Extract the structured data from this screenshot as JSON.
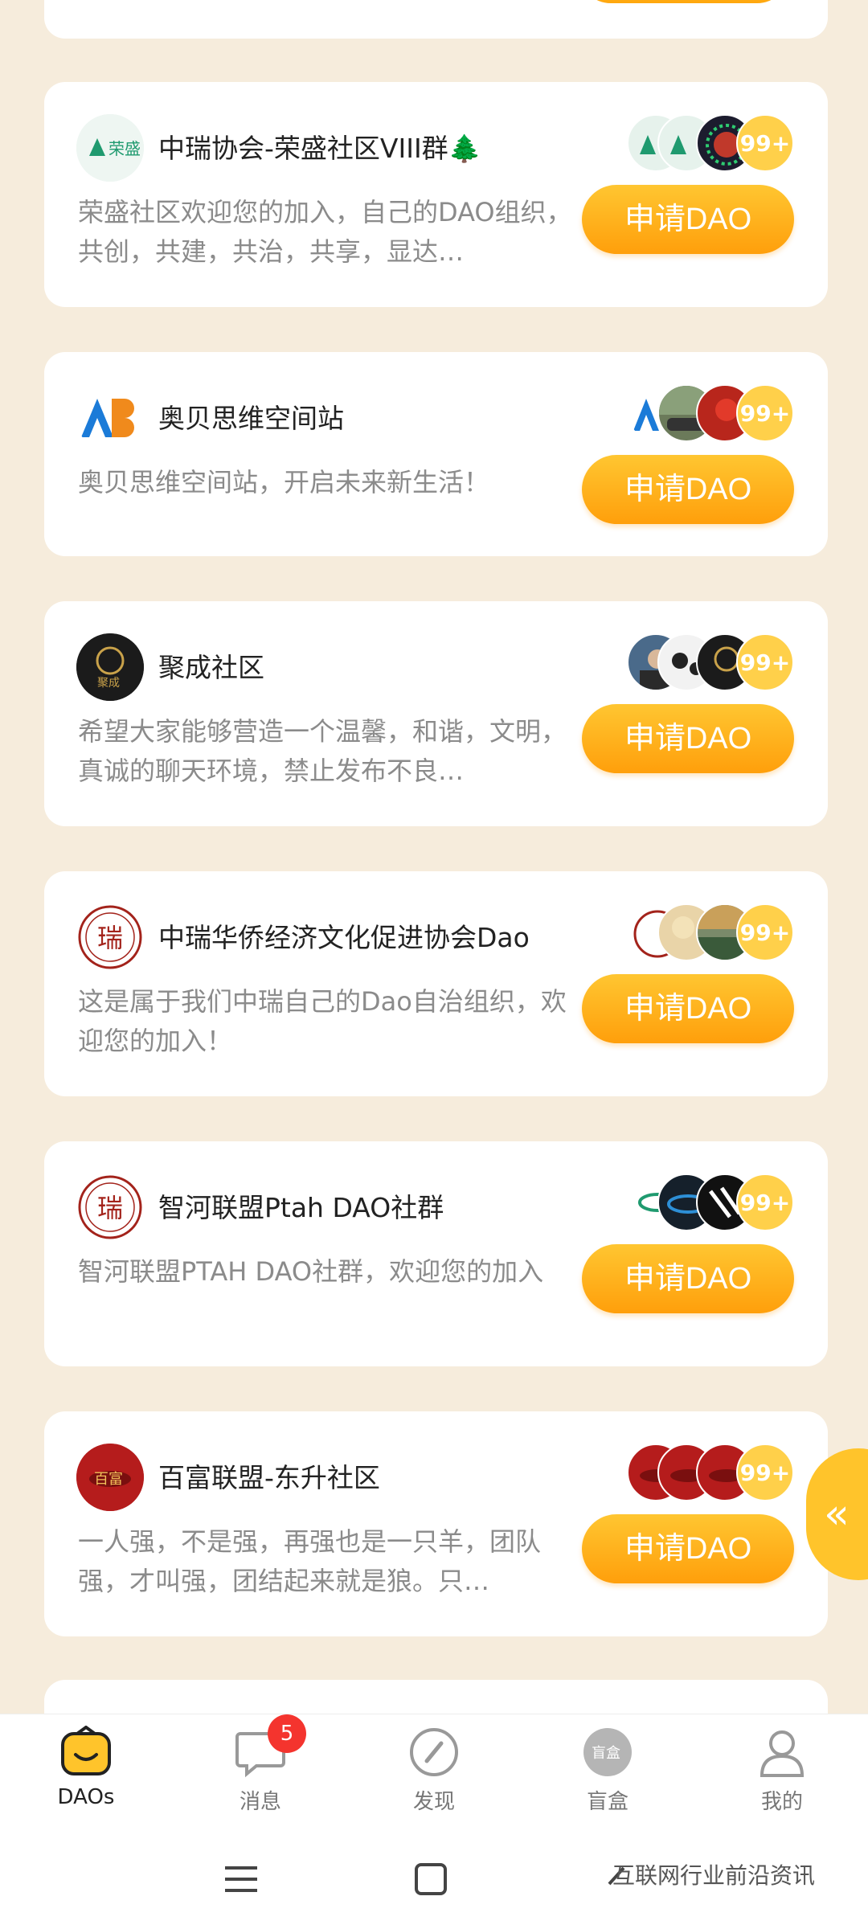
{
  "communities": [
    {
      "name": "中瑞协会-荣盛社区VIII群🌲",
      "description": "荣盛社区欢迎您的加入，自己的DAO组织，共创，共建，共治，共享，显达…",
      "more_count": "99+",
      "button_label": "申请DAO",
      "avatar_text": "荣盛"
    },
    {
      "name": "奥贝思维空间站",
      "description": "奥贝思维空间站，开启未来新生活！",
      "more_count": "99+",
      "button_label": "申请DAO",
      "avatar_text": "AB"
    },
    {
      "name": "聚成社区",
      "description": "希望大家能够营造一个温馨，和谐，文明，真诚的聊天环境，禁止发布不良…",
      "more_count": "99+",
      "button_label": "申请DAO",
      "avatar_text": "聚成"
    },
    {
      "name": "中瑞华侨经济文化促进协会Dao",
      "description": "这是属于我们中瑞自己的Dao自治组织，欢迎您的加入！",
      "more_count": "99+",
      "button_label": "申请DAO",
      "avatar_text": "瑞"
    },
    {
      "name": "智河联盟Ptah DAO社群",
      "description": "智河联盟PTAH DAO社群，欢迎您的加入",
      "more_count": "99+",
      "button_label": "申请DAO",
      "avatar_text": "瑞"
    },
    {
      "name": "百富联盟-东升社区",
      "description": "一人强，不是强，再强也是一只羊，团队强，才叫强，团结起来就是狼。只…",
      "more_count": "99+",
      "button_label": "申请DAO",
      "avatar_text": "百富"
    }
  ],
  "side_tab": {
    "label": "«"
  },
  "tabbar": {
    "daos": "DAOs",
    "messages": "消息",
    "messages_badge": "5",
    "discover": "发现",
    "blindbox": "盲盒",
    "blindbox_icon_text": "盲盒",
    "me": "我的"
  },
  "watermark": "互联网行业前沿资讯",
  "colors": {
    "accent": "#ffb21d",
    "background": "#f6ecdc",
    "badge": "#f4342e"
  }
}
